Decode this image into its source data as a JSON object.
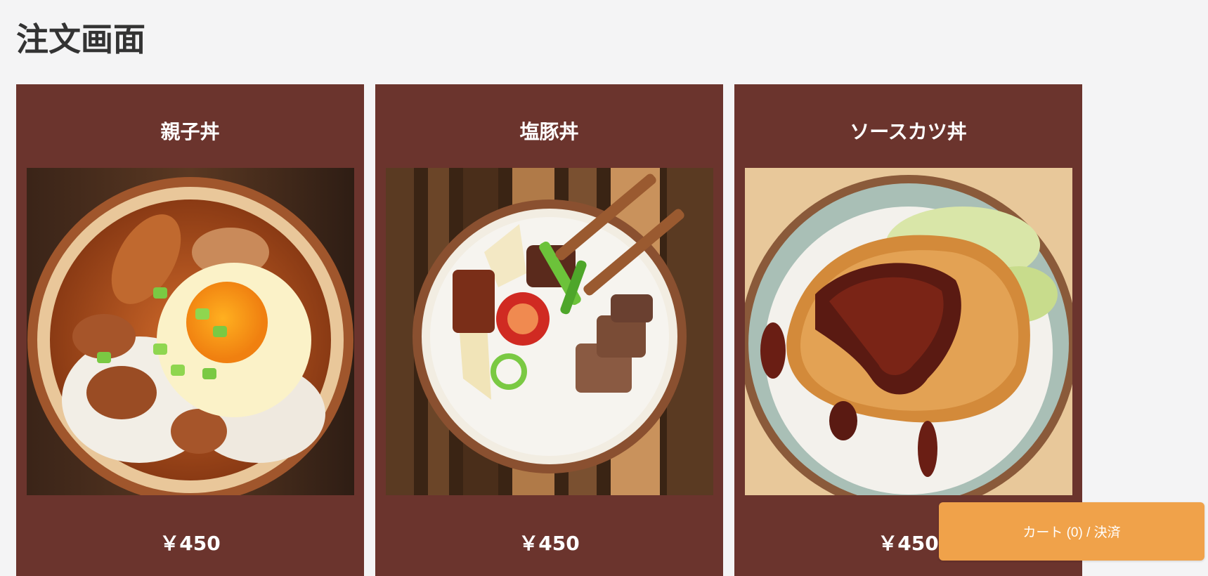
{
  "page": {
    "title": "注文画面"
  },
  "menu": {
    "items": [
      {
        "name": "親子丼",
        "price": "￥450",
        "image": "oyakodon-photo"
      },
      {
        "name": "塩豚丼",
        "price": "￥450",
        "image": "shiobutadon-photo"
      },
      {
        "name": "ソースカツ丼",
        "price": "￥450",
        "image": "sauce-katsudon-photo"
      }
    ]
  },
  "cart": {
    "label": "カート (0) / 決済"
  },
  "colors": {
    "background": "#f4f4f5",
    "card": "#6b342d",
    "cart_button": "#f0a24a",
    "text_dark": "#333333",
    "text_light": "#ffffff"
  }
}
